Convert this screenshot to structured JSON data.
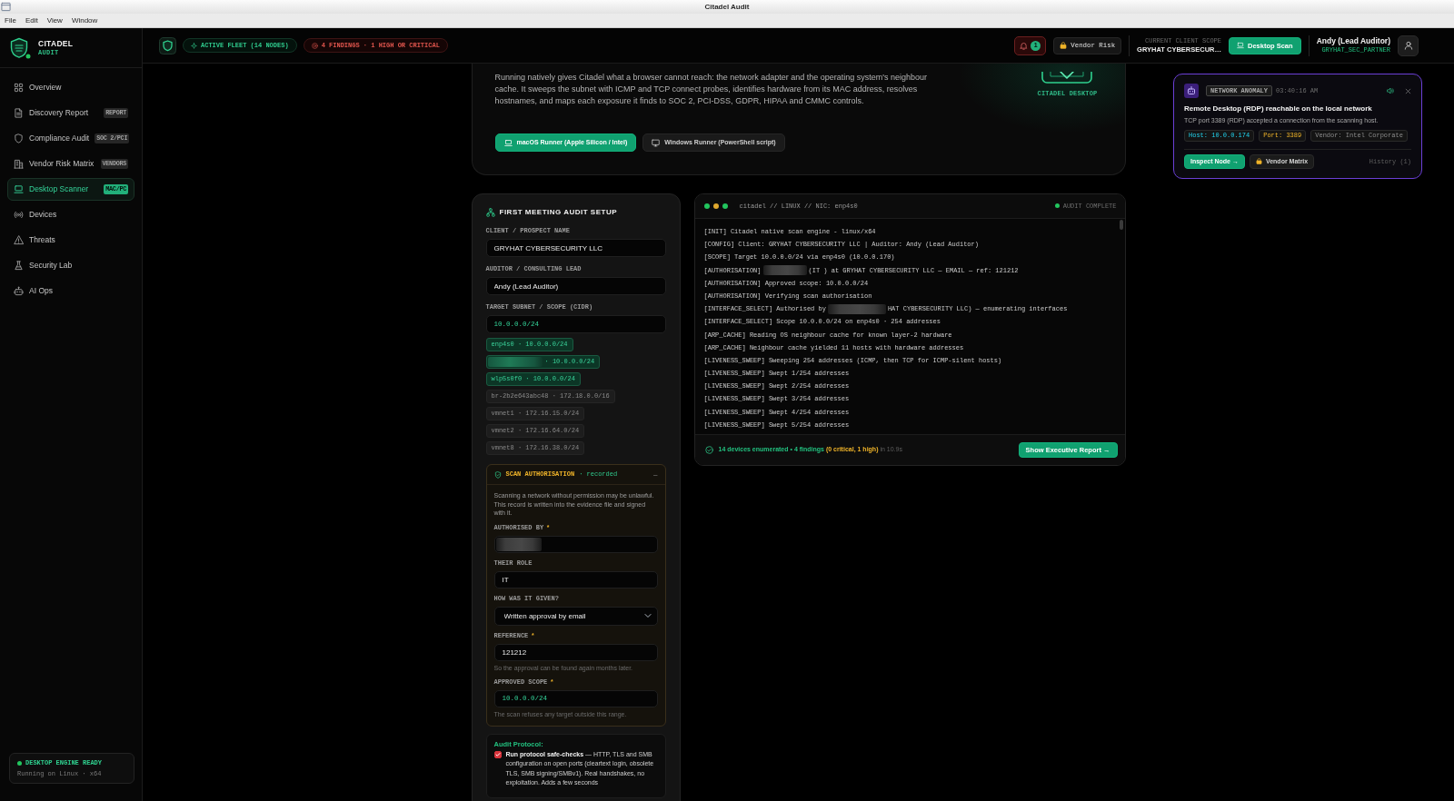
{
  "window": {
    "title": "Citadel Audit",
    "menu": [
      "File",
      "Edit",
      "View",
      "Window"
    ]
  },
  "sidebar": {
    "brand": {
      "name": "CITADEL",
      "subtitle": "AUDIT"
    },
    "items": [
      {
        "label": "Overview",
        "selected": false
      },
      {
        "label": "Discovery Report",
        "badge": "REPORT",
        "selected": false
      },
      {
        "label": "Compliance Audit",
        "badge": "SOC 2/PCI",
        "selected": false
      },
      {
        "label": "Vendor Risk Matrix",
        "badge": "VENDORS",
        "selected": false
      },
      {
        "label": "Desktop Scanner",
        "badge": "MAC/PC",
        "selected": true
      },
      {
        "label": "Devices",
        "selected": false
      },
      {
        "label": "Threats",
        "selected": false
      },
      {
        "label": "Security Lab",
        "selected": false
      },
      {
        "label": "AI Ops",
        "selected": false
      }
    ],
    "engine_status": {
      "title": "DESKTOP ENGINE READY",
      "detail": "Running on Linux · x64"
    }
  },
  "header": {
    "pills": [
      {
        "label": "ACTIVE FLEET (14 NODES)",
        "kind": "ok"
      },
      {
        "label": "4 FINDINGS · 1 HIGH OR CRITICAL",
        "kind": "alert"
      }
    ],
    "notifications": "1",
    "vendor_button": "Vendor Risk",
    "client_scope": {
      "label": "CURRENT CLIENT SCOPE",
      "value": "GRYHAT CYBERSECUR…"
    },
    "scan_button": "Desktop Scan",
    "user": {
      "name": "Andy (Lead Auditor)",
      "role": "GRYHAT_SEC_PARTNER"
    }
  },
  "hero": {
    "description": "Running natively gives Citadel what a browser cannot reach: the network adapter and the operating system's neighbour cache. It sweeps the subnet with ICMP and TCP connect probes, identifies hardware from its MAC address, resolves hostnames, and maps each exposure it finds to SOC 2, PCI-DSS, GDPR, HIPAA and CMMC controls.",
    "buttons": [
      {
        "label": "macOS Runner (Apple Silicon / Intel)",
        "kind": "primary"
      },
      {
        "label": "Windows Runner (PowerShell script)",
        "kind": "secondary"
      }
    ],
    "logo_caption": "CITADEL DESKTOP"
  },
  "setup": {
    "title": "FIRST MEETING AUDIT SETUP",
    "fields": [
      {
        "label": "CLIENT / PROSPECT NAME",
        "value": "GRYHAT CYBERSECURITY LLC",
        "kind": "text"
      },
      {
        "label": "AUDITOR / CONSULTING LEAD",
        "value": "Andy (Lead Auditor)",
        "kind": "text"
      },
      {
        "label": "TARGET SUBNET / SCOPE (CIDR)",
        "value": "10.0.0.0/24",
        "kind": "cidr"
      }
    ],
    "interfaces": [
      {
        "label": "enp4s0 · 10.0.0.0/24",
        "selected": true,
        "redacted": false
      },
      {
        "label": "· 10.0.0.0/24",
        "selected": true,
        "redacted": true
      },
      {
        "label": "wlp5s0f0 · 10.0.0.0/24",
        "selected": true,
        "redacted": false
      },
      {
        "label": "br-2b2e643abc48 · 172.18.0.0/16",
        "selected": false,
        "redacted": false
      },
      {
        "label": "vmnet1 · 172.16.15.0/24",
        "selected": false,
        "redacted": false
      },
      {
        "label": "vmnet2 · 172.16.64.0/24",
        "selected": false,
        "redacted": false
      },
      {
        "label": "vmnet8 · 172.16.38.0/24",
        "selected": false,
        "redacted": false
      }
    ],
    "authorisation": {
      "title": "SCAN AUTHORISATION",
      "status": "· recorded",
      "toggle": "–",
      "notice": "Scanning a network without permission may be unlawful. This record is written into the evidence file and signed with it.",
      "fields": [
        {
          "label": "AUTHORISED BY",
          "marker": "*",
          "kind": "redacted"
        },
        {
          "label": "THEIR ROLE",
          "value": "IT",
          "kind": "text"
        },
        {
          "label": "HOW WAS IT GIVEN?",
          "value": "Written approval by email",
          "kind": "select"
        },
        {
          "label": "REFERENCE",
          "marker": "*",
          "value": "121212",
          "kind": "text",
          "hint": "So the approval can be found again months later."
        },
        {
          "label": "APPROVED SCOPE",
          "marker": "*",
          "value": "10.0.0.0/24",
          "kind": "cidr",
          "hint": "The scan refuses any target outside this range."
        }
      ]
    },
    "protocol": {
      "title": "Audit Protocol:",
      "options": [
        {
          "text": "**Run protocol safe-checks** — HTTP, TLS and SMB configuration on open ports (cleartext login, obsolete TLS, SMB signing/SMBv1). Real handshakes, no exploitation. Adds a few seconds",
          "checked": true
        }
      ]
    }
  },
  "terminal": {
    "title": "citadel // LINUX // NIC: enp4s0",
    "status": "AUDIT COMPLETE",
    "lines": [
      {
        "kind": "plain",
        "text": "[INIT] Citadel native scan engine - linux/x64"
      },
      {
        "kind": "plain",
        "text": "[CONFIG] Client: GRYHAT CYBERSECURITY LLC | Auditor: Andy (Lead Auditor)"
      },
      {
        "kind": "plain",
        "text": "[SCOPE] Target 10.0.0.0/24 via enp4s0 (10.0.0.170)"
      },
      {
        "kind": "redacted",
        "before": "[AUTHORISATION]",
        "after": "(IT ) at GRYHAT CYBERSECURITY LLC — EMAIL — ref: 121212"
      },
      {
        "kind": "plain",
        "text": "[AUTHORISATION] Approved scope: 10.0.0.0/24"
      },
      {
        "kind": "plain",
        "text": "[AUTHORISATION] Verifying scan authorisation"
      },
      {
        "kind": "redacted",
        "before": "[INTERFACE_SELECT] Authorised by",
        "after": "HAT CYBERSECURITY LLC) — enumerating interfaces"
      },
      {
        "kind": "plain",
        "text": "[INTERFACE_SELECT] Scope 10.0.0.0/24 on enp4s0 · 254 addresses"
      },
      {
        "kind": "plain",
        "text": "[ARP_CACHE] Reading OS neighbour cache for known layer-2 hardware"
      },
      {
        "kind": "plain",
        "text": "[ARP_CACHE] Neighbour cache yielded 11 hosts with hardware addresses"
      },
      {
        "kind": "plain",
        "text": "[LIVENESS_SWEEP] Sweeping 254 addresses (ICMP, then TCP for ICMP-silent hosts)"
      },
      {
        "kind": "plain",
        "text": "[LIVENESS_SWEEP] Swept 1/254 addresses"
      },
      {
        "kind": "plain",
        "text": "[LIVENESS_SWEEP] Swept 2/254 addresses"
      },
      {
        "kind": "plain",
        "text": "[LIVENESS_SWEEP] Swept 3/254 addresses"
      },
      {
        "kind": "plain",
        "text": "[LIVENESS_SWEEP] Swept 4/254 addresses"
      },
      {
        "kind": "plain",
        "text": "[LIVENESS_SWEEP] Swept 5/254 addresses"
      }
    ],
    "footer": {
      "summary": "14 devices enumerated • 4 findings",
      "severity": "(0 critical, 1 high)",
      "duration": "in 10.9s",
      "button": "Show Executive Report →"
    }
  },
  "toast": {
    "tag": "NETWORK ANOMALY",
    "time": "03:40:16 AM",
    "title": "Remote Desktop (RDP) reachable on the local network",
    "message": "TCP port 3389 (RDP) accepted a connection from the scanning host.",
    "facts": [
      {
        "text": "Host: 10.0.0.174",
        "kind": "host"
      },
      {
        "text": "Port: 3389",
        "kind": "port"
      },
      {
        "text": "Vendor: Intel Corporate",
        "kind": "vendor"
      }
    ],
    "actions": [
      {
        "label": "Inspect Node →",
        "kind": "primary"
      },
      {
        "label": "Vendor Matrix",
        "kind": "secondary"
      }
    ],
    "history": "History (1)"
  }
}
